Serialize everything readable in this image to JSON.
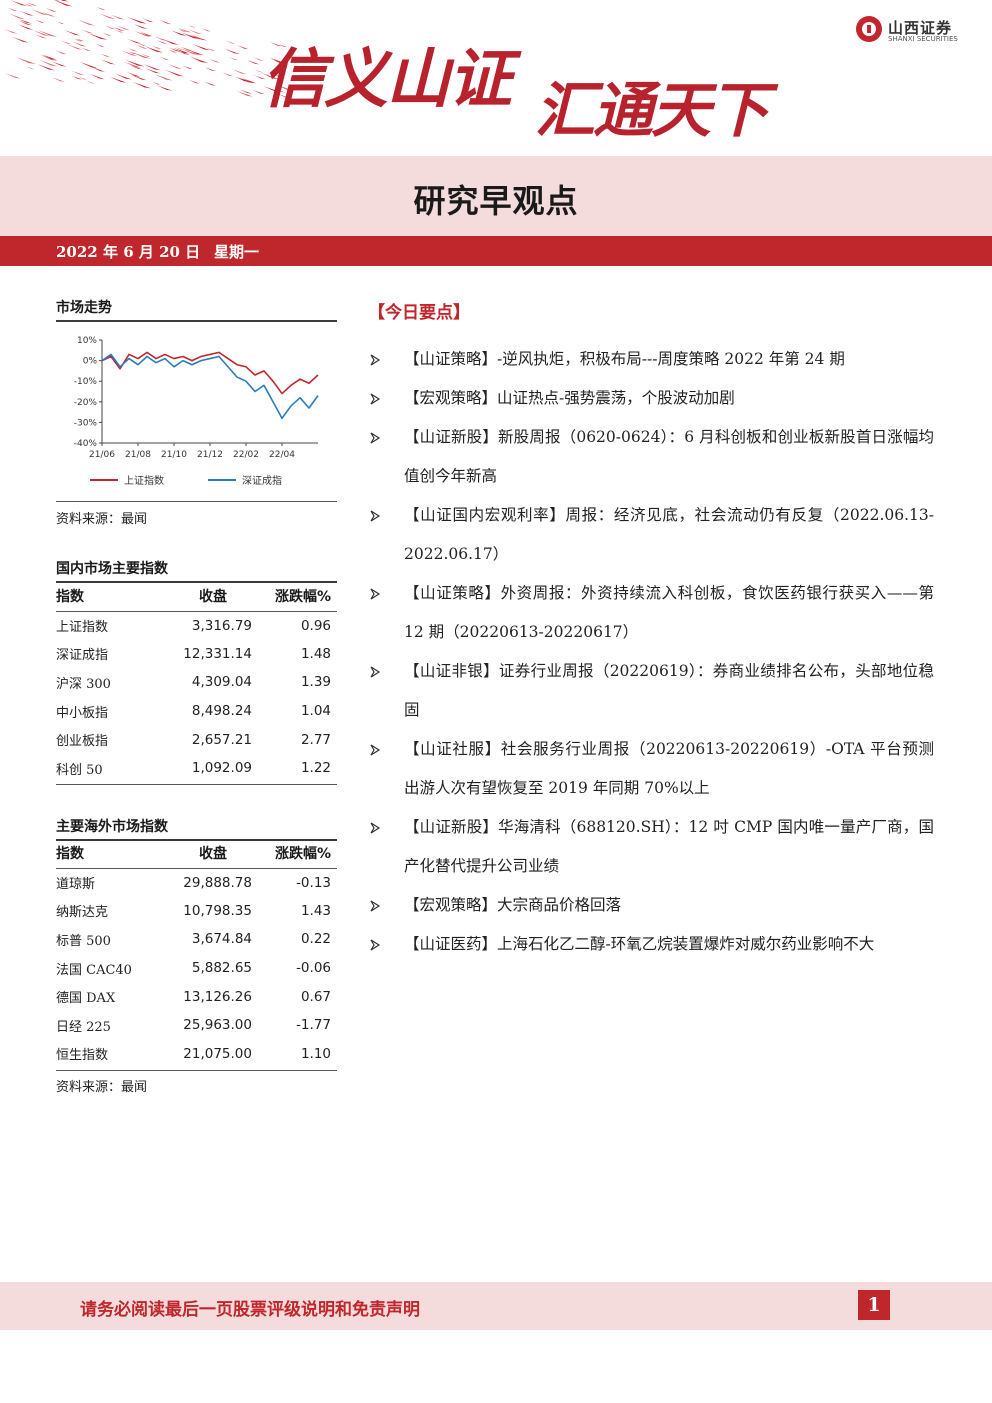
{
  "header": {
    "slogan_part1": "信义山证",
    "slogan_part2": "汇通天下",
    "logo_cn": "山西证券",
    "logo_en": "SHANXI SECURITIES",
    "report_title": "研究早观点",
    "date": "2022 年 6 月 20 日",
    "weekday": "星期一",
    "colors": {
      "brand_red": "#c0272d",
      "light_pink": "#f4dcdd"
    }
  },
  "market_trend": {
    "heading": "市场走势",
    "source": "资料来源：最闻",
    "chart_data": {
      "type": "line",
      "title": "",
      "xlabel": "",
      "ylabel": "",
      "ylim": [
        -40,
        10
      ],
      "yticks": [
        "10%",
        "0%",
        "-10%",
        "-20%",
        "-30%",
        "-40%"
      ],
      "ytick_values": [
        10,
        0,
        -10,
        -20,
        -30,
        -40
      ],
      "xticks": [
        "21/06",
        "21/08",
        "21/10",
        "21/12",
        "22/02",
        "22/04"
      ],
      "xtick_positions": [
        0,
        2,
        4,
        6,
        8,
        10
      ],
      "xlim": [
        0,
        12
      ],
      "legend_position": "bottom",
      "grid": false,
      "series": [
        {
          "name": "上证指数",
          "color": "#c0272d",
          "x": [
            0,
            0.5,
            1,
            1.5,
            2,
            2.5,
            3,
            3.5,
            4,
            4.5,
            5,
            5.5,
            6,
            6.5,
            7,
            7.5,
            8,
            8.5,
            9,
            9.5,
            10,
            10.5,
            11,
            11.5,
            12
          ],
          "y": [
            0,
            2,
            -4,
            3,
            1,
            4,
            1,
            3,
            1,
            2,
            0,
            2,
            3,
            4,
            1,
            -2,
            -3,
            -7,
            -5,
            -10,
            -16,
            -12,
            -9,
            -11,
            -7
          ]
        },
        {
          "name": "深证成指",
          "color": "#2b7bbf",
          "x": [
            0,
            0.5,
            1,
            1.5,
            2,
            2.5,
            3,
            3.5,
            4,
            4.5,
            5,
            5.5,
            6,
            6.5,
            7,
            7.5,
            8,
            8.5,
            9,
            9.5,
            10,
            10.5,
            11,
            11.5,
            12
          ],
          "y": [
            0,
            3,
            -3,
            1,
            -2,
            2,
            -1,
            1,
            -3,
            0,
            -2,
            0,
            1,
            2,
            -3,
            -8,
            -10,
            -15,
            -12,
            -20,
            -28,
            -22,
            -18,
            -23,
            -17
          ]
        }
      ]
    }
  },
  "domestic": {
    "heading": "国内市场主要指数",
    "columns": [
      "指数",
      "收盘",
      "涨跌幅%"
    ],
    "rows": [
      [
        "上证指数",
        "3,316.79",
        "0.96"
      ],
      [
        "深证成指",
        "12,331.14",
        "1.48"
      ],
      [
        "沪深 300",
        "4,309.04",
        "1.39"
      ],
      [
        "中小板指",
        "8,498.24",
        "1.04"
      ],
      [
        "创业板指",
        "2,657.21",
        "2.77"
      ],
      [
        "科创 50",
        "1,092.09",
        "1.22"
      ]
    ]
  },
  "overseas": {
    "heading": "主要海外市场指数",
    "columns": [
      "指数",
      "收盘",
      "涨跌幅%"
    ],
    "rows": [
      [
        "道琼斯",
        "29,888.78",
        "-0.13"
      ],
      [
        "纳斯达克",
        "10,798.35",
        "1.43"
      ],
      [
        "标普 500",
        "3,674.84",
        "0.22"
      ],
      [
        "法国 CAC40",
        "5,882.65",
        "-0.06"
      ],
      [
        "德国 DAX",
        "13,126.26",
        "0.67"
      ],
      [
        "日经 225",
        "25,963.00",
        "-1.77"
      ],
      [
        "恒生指数",
        "21,075.00",
        "1.10"
      ]
    ],
    "source": "资料来源：最闻"
  },
  "key_points": {
    "heading": "【今日要点】",
    "items": [
      "【山证策略】-逆风执炬，积极布局---周度策略 2022 年第 24 期",
      "【宏观策略】山证热点-强势震荡，个股波动加剧",
      "【山证新股】新股周报（0620-0624）：6 月科创板和创业板新股首日涨幅均值创今年新高",
      "【山证国内宏观利率】周报：经济见底，社会流动仍有反复（2022.06.13-2022.06.17）",
      "【山证策略】外资周报：外资持续流入科创板，食饮医药银行获买入——第 12 期（20220613-20220617）",
      "【山证非银】证券行业周报（20220619）：券商业绩排名公布，头部地位稳固",
      "【山证社服】社会服务行业周报（20220613-20220619）-OTA 平台预测出游人次有望恢复至 2019 年同期 70%以上",
      "【山证新股】华海清科（688120.SH）：12 吋 CMP 国内唯一量产厂商，国产化替代提升公司业绩",
      "【宏观策略】大宗商品价格回落",
      "【山证医药】上海石化乙二醇-环氧乙烷装置爆炸对威尔药业影响不大"
    ]
  },
  "footer": {
    "disclaimer": "请务必阅读最后一页股票评级说明和免责声明",
    "page_number": "1"
  }
}
